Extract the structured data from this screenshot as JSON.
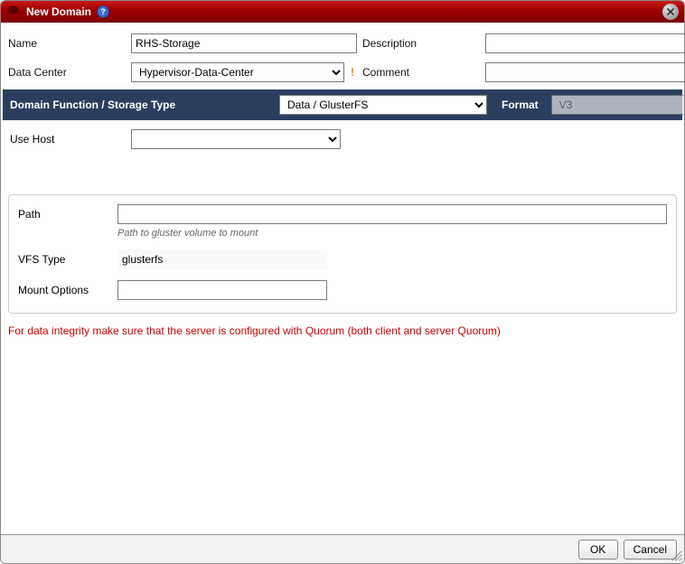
{
  "dialog": {
    "title": "New Domain"
  },
  "fields": {
    "name_label": "Name",
    "name_value": "RHS-Storage",
    "description_label": "Description",
    "description_value": "",
    "data_center_label": "Data Center",
    "data_center_value": "Hypervisor-Data-Center",
    "comment_label": "Comment",
    "comment_value": ""
  },
  "storage_bar": {
    "label": "Domain Function / Storage Type",
    "value": "Data / GlusterFS",
    "format_label": "Format",
    "format_value": "V3"
  },
  "host": {
    "label": "Use Host",
    "value": ""
  },
  "gluster": {
    "path_label": "Path",
    "path_value": "",
    "path_hint": "Path to gluster volume to mount",
    "vfs_label": "VFS Type",
    "vfs_value": "glusterfs",
    "mount_label": "Mount Options",
    "mount_value": ""
  },
  "integrity_note": "For data integrity make sure that the server is configured with Quorum (both client and server Quorum)",
  "buttons": {
    "ok": "OK",
    "cancel": "Cancel"
  }
}
